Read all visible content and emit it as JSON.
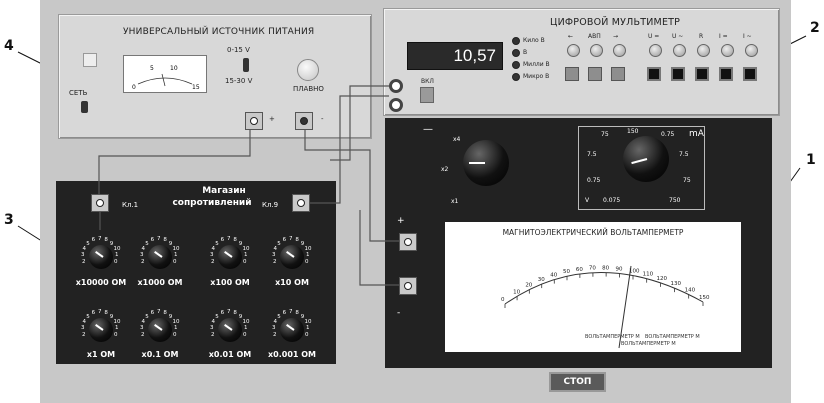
{
  "callouts": {
    "n4": "4",
    "n2": "2",
    "n3": "3",
    "n1": "1"
  },
  "psu": {
    "title": "УНИВЕРСАЛЬНЫЙ ИСТОЧНИК ПИТАНИЯ",
    "power_label": "СЕТЬ",
    "range_low": "0-15 V",
    "range_high": "15-30 V",
    "smooth_label": "ПЛАВНО",
    "plus": "+",
    "minus": "-",
    "meter_ticks": [
      "0",
      "5",
      "10",
      "15"
    ]
  },
  "multimeter": {
    "title": "ЦИФРОВОЙ МУЛЬТИМЕТР",
    "display_value": "10,57",
    "on_label": "ВКЛ",
    "units": [
      "Кило В",
      "В",
      "Милли В",
      "Микро В"
    ],
    "top_buttons": [
      "←",
      "АВП",
      "→",
      "U =",
      "U ~",
      "R",
      "I =",
      "I ~"
    ]
  },
  "resistance_box": {
    "title_line1": "Магазин",
    "title_line2": "сопротивлений",
    "key1": "Кл.1",
    "key9": "Кл.9",
    "dial_numbers": [
      "2",
      "3",
      "4",
      "5",
      "6",
      "7",
      "8",
      "9",
      "10",
      "1",
      "0"
    ],
    "decades": [
      "x10000 ОМ",
      "x1000 ОМ",
      "x100 ОМ",
      "x10 ОМ",
      "x1 ОМ",
      "x0.1 ОМ",
      "x0.01 ОМ",
      "x0.001 ОМ"
    ]
  },
  "voltammeter": {
    "dash": "—",
    "mult_labels": [
      "x4",
      "x2",
      "x1"
    ],
    "range_top": [
      "75",
      "150",
      "0.75"
    ],
    "range_mid_left": "7.5",
    "range_mid_right": "7.5",
    "range_low_left": "0.75",
    "range_low_right": "75",
    "range_bottom": [
      "0.075",
      "750"
    ],
    "unit_v": "V",
    "unit_ma": "mA",
    "side_plus": "+",
    "side_minus": "-",
    "scale_title": "МАГНИТОЭЛЕКТРИЧЕСКИЙ ВОЛЬТАМПЕРМЕТР",
    "scale_values": [
      "0",
      "10",
      "20",
      "30",
      "40",
      "50",
      "60",
      "70",
      "80",
      "90",
      "100",
      "110",
      "120",
      "130",
      "140",
      "150"
    ],
    "model_text_1": "ВОЛЬТАМПЕРМЕТР М",
    "model_text_2": "ВОЛЬТАМПЕРМЕТР М",
    "model_text_3": "ВОЛЬТАМПЕРМЕТР М"
  },
  "stop_button": "СТОП"
}
